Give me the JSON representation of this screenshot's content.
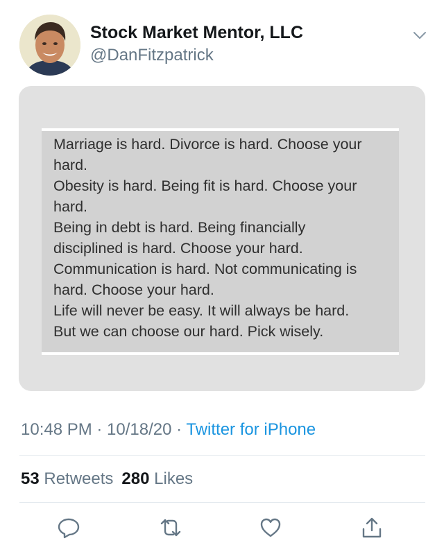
{
  "tweet": {
    "display_name": "Stock Market Mentor, LLC",
    "handle": "@DanFitzpatrick",
    "timestamp": "10:48 PM · 10/18/20 · ",
    "source": "Twitter for iPhone",
    "menu_icon": "chevron-down-icon"
  },
  "image_text": {
    "lines": [
      "Marriage is hard. Divorce is hard. Choose your",
      "hard.",
      "Obesity is hard. Being fit is hard. Choose your",
      "hard.",
      "Being in debt is hard. Being financially",
      "disciplined is hard. Choose your hard.",
      "Communication is hard. Not communicating is",
      "hard. Choose your hard.",
      "Life will never be easy. It will always be hard.",
      "But we can choose our hard. Pick wisely."
    ]
  },
  "stats": {
    "retweets_count": "53",
    "retweets_label": "Retweets",
    "likes_count": "280",
    "likes_label": "Likes"
  },
  "actions": [
    {
      "name": "reply",
      "icon": "reply-icon"
    },
    {
      "name": "retweet",
      "icon": "retweet-icon"
    },
    {
      "name": "like",
      "icon": "heart-icon"
    },
    {
      "name": "share",
      "icon": "share-icon"
    }
  ],
  "colors": {
    "name": "#14171a",
    "secondary": "#657786",
    "link": "#1b95e0",
    "card": "#e1e1e1",
    "note": "#d2d2d2"
  }
}
